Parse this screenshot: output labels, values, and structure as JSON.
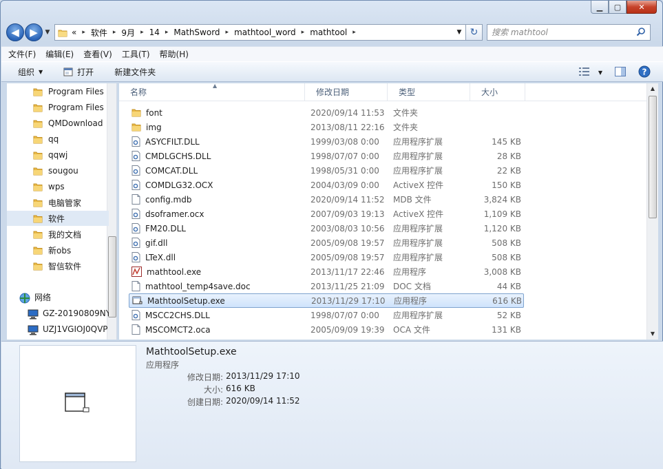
{
  "window": {
    "minimize_icon": "minimize-icon",
    "maximize_icon": "maximize-icon",
    "close_icon": "close-icon"
  },
  "address": {
    "overflow": "«",
    "crumbs": [
      "软件",
      "9月",
      "14",
      "MathSword",
      "mathtool_word",
      "mathtool"
    ]
  },
  "search": {
    "placeholder": "搜索 mathtool"
  },
  "menu": [
    "文件(F)",
    "编辑(E)",
    "查看(V)",
    "工具(T)",
    "帮助(H)"
  ],
  "toolbar": {
    "organize": "组织",
    "open": "打开",
    "new_folder": "新建文件夹"
  },
  "nav": {
    "items": [
      {
        "label": "Program Files",
        "icon": "folder-icon"
      },
      {
        "label": "Program Files",
        "icon": "folder-icon"
      },
      {
        "label": "QMDownload",
        "icon": "folder-icon"
      },
      {
        "label": "qq",
        "icon": "folder-icon"
      },
      {
        "label": "qqwj",
        "icon": "folder-icon"
      },
      {
        "label": "sougou",
        "icon": "folder-icon"
      },
      {
        "label": "wps",
        "icon": "folder-icon"
      },
      {
        "label": "电脑管家",
        "icon": "folder-icon"
      },
      {
        "label": "软件",
        "icon": "folder-icon",
        "selected": true
      },
      {
        "label": "我的文档",
        "icon": "folder-icon"
      },
      {
        "label": "新obs",
        "icon": "folder-icon"
      },
      {
        "label": "智信软件",
        "icon": "folder-icon"
      }
    ],
    "network": {
      "label": "网络",
      "icon": "network-icon"
    },
    "computers": [
      {
        "label": "GZ-20190809NY",
        "icon": "computer-icon"
      },
      {
        "label": "UZJ1VGIOJ0QVP",
        "icon": "computer-icon"
      }
    ]
  },
  "columns": {
    "name": "名称",
    "date": "修改日期",
    "type": "类型",
    "size": "大小"
  },
  "files": [
    {
      "name": "font",
      "date": "2020/09/14 11:53",
      "type": "文件夹",
      "size": "",
      "icon": "folder-icon"
    },
    {
      "name": "img",
      "date": "2013/08/11 22:16",
      "type": "文件夹",
      "size": "",
      "icon": "folder-icon"
    },
    {
      "name": "ASYCFILT.DLL",
      "date": "1999/03/08 0:00",
      "type": "应用程序扩展",
      "size": "145 KB",
      "icon": "dll-icon"
    },
    {
      "name": "CMDLGCHS.DLL",
      "date": "1998/07/07 0:00",
      "type": "应用程序扩展",
      "size": "28 KB",
      "icon": "dll-icon"
    },
    {
      "name": "COMCAT.DLL",
      "date": "1998/05/31 0:00",
      "type": "应用程序扩展",
      "size": "22 KB",
      "icon": "dll-icon"
    },
    {
      "name": "COMDLG32.OCX",
      "date": "2004/03/09 0:00",
      "type": "ActiveX 控件",
      "size": "150 KB",
      "icon": "dll-icon"
    },
    {
      "name": "config.mdb",
      "date": "2020/09/14 11:52",
      "type": "MDB 文件",
      "size": "3,824 KB",
      "icon": "file-icon"
    },
    {
      "name": "dsoframer.ocx",
      "date": "2007/09/03 19:13",
      "type": "ActiveX 控件",
      "size": "1,109 KB",
      "icon": "dll-icon"
    },
    {
      "name": "FM20.DLL",
      "date": "2003/08/03 10:56",
      "type": "应用程序扩展",
      "size": "1,120 KB",
      "icon": "dll-icon"
    },
    {
      "name": "gif.dll",
      "date": "2005/09/08 19:57",
      "type": "应用程序扩展",
      "size": "508 KB",
      "icon": "dll-icon"
    },
    {
      "name": "LTeX.dll",
      "date": "2005/09/08 19:57",
      "type": "应用程序扩展",
      "size": "508 KB",
      "icon": "dll-icon"
    },
    {
      "name": "mathtool.exe",
      "date": "2013/11/17 22:46",
      "type": "应用程序",
      "size": "3,008 KB",
      "icon": "mathtool-exe-icon"
    },
    {
      "name": "mathtool_temp4save.doc",
      "date": "2013/11/25 21:09",
      "type": "DOC 文档",
      "size": "44 KB",
      "icon": "file-icon"
    },
    {
      "name": "MathtoolSetup.exe",
      "date": "2013/11/29 17:10",
      "type": "应用程序",
      "size": "616 KB",
      "icon": "exe-icon",
      "selected": true
    },
    {
      "name": "MSCC2CHS.DLL",
      "date": "1998/07/07 0:00",
      "type": "应用程序扩展",
      "size": "52 KB",
      "icon": "dll-icon"
    },
    {
      "name": "MSCOMCT2.oca",
      "date": "2005/09/09 19:39",
      "type": "OCA 文件",
      "size": "131 KB",
      "icon": "file-icon"
    }
  ],
  "details": {
    "name": "MathtoolSetup.exe",
    "type": "应用程序",
    "modified_label": "修改日期:",
    "modified": "2013/11/29 17:10",
    "size_label": "大小:",
    "size": "616 KB",
    "created_label": "创建日期:",
    "created": "2020/09/14 11:52"
  }
}
